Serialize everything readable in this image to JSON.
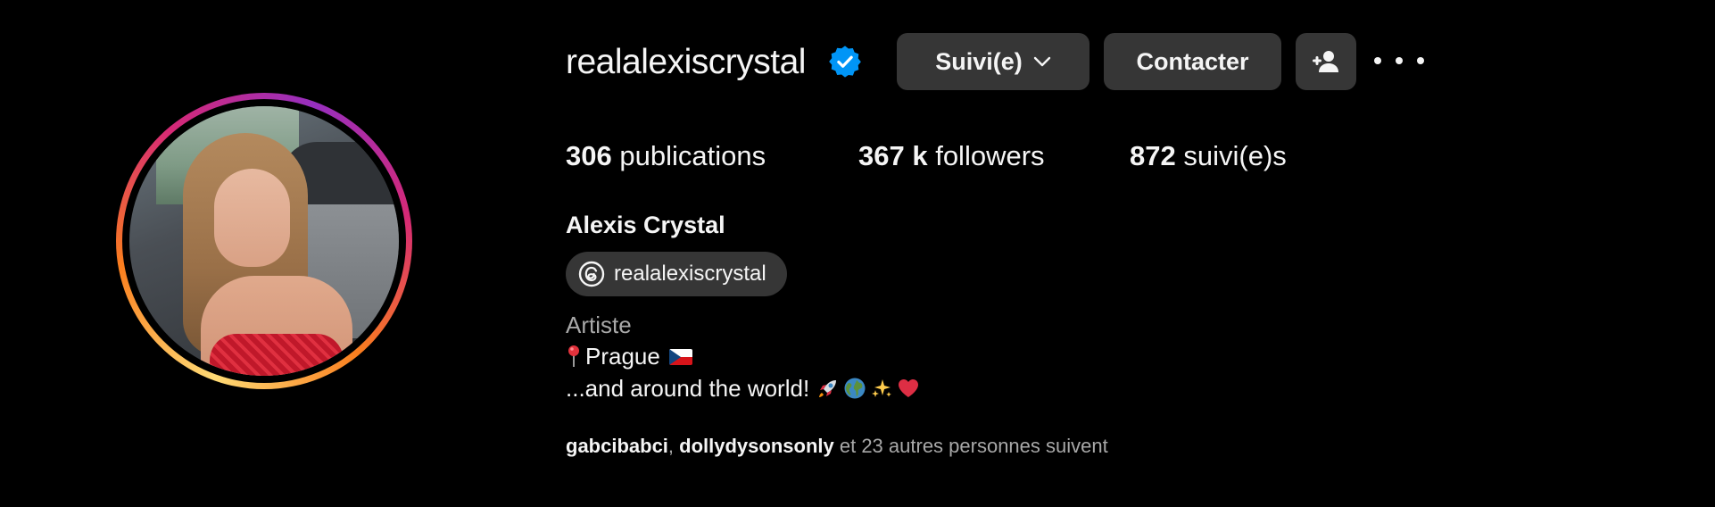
{
  "profile": {
    "username": "realalexiscrystal",
    "verified": true,
    "full_name": "Alexis Crystal",
    "threads_handle": "realalexiscrystal",
    "category": "Artiste",
    "bio_line_1": "Prague",
    "bio_line_2": "...and around the world!"
  },
  "actions": {
    "follow_label": "Suivi(e)",
    "contact_label": "Contacter"
  },
  "stats": {
    "posts_count": "306",
    "posts_label": "publications",
    "followers_count": "367 k",
    "followers_label": "followers",
    "following_count": "872",
    "following_label": "suivi(e)s"
  },
  "mutuals": {
    "name_1": "gabcibabci",
    "separator": ", ",
    "name_2": "dollydysonsonly",
    "suffix": " et 23 autres personnes suivent"
  },
  "icons": {
    "verified": "verified-badge-icon",
    "follow_dropdown": "chevron-down-icon",
    "add_user": "add-user-icon",
    "more": "more-options-icon",
    "threads": "threads-icon",
    "pin": "round-pushpin-icon",
    "flag": "czech-flag-icon",
    "emojis": [
      "rocket-icon",
      "globe-icon",
      "sparkles-icon",
      "red-heart-icon"
    ]
  },
  "colors": {
    "background": "#000000",
    "button_bg": "#363636",
    "text_primary": "#f5f5f5",
    "text_secondary": "#a8a8a8",
    "verified_blue": "#0095f6"
  }
}
